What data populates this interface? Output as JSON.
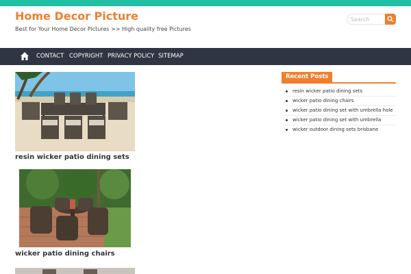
{
  "site": {
    "title": "Home Decor Picture",
    "tagline": "Best for Your Home Decor Pictures >> High quality free Pictures"
  },
  "search": {
    "placeholder": "Search"
  },
  "nav": {
    "items": [
      {
        "label": "CONTACT"
      },
      {
        "label": "COPYRIGHT"
      },
      {
        "label": "PRIVACY POLICY"
      },
      {
        "label": "SITEMAP"
      }
    ]
  },
  "posts": [
    {
      "title": "resin wicker patio dining sets",
      "image_alt": "Patio dining set on beach"
    },
    {
      "title": "wicker patio dining chairs",
      "image_alt": "Wicker dining chairs on brick patio"
    }
  ],
  "sidebar": {
    "widget_title": "Recent Posts",
    "recent": [
      {
        "label": "resin wicker patio dining sets"
      },
      {
        "label": "wicker patio dining chairs"
      },
      {
        "label": "wicker patio dining set with umbrella hole"
      },
      {
        "label": "wicker patio dining set with umbrella"
      },
      {
        "label": "wicker outdoor dining sets brisbane"
      }
    ]
  },
  "colors": {
    "accent": "#ef7f2f",
    "topbar": "#21bfa3",
    "navbar": "#2f3542"
  }
}
